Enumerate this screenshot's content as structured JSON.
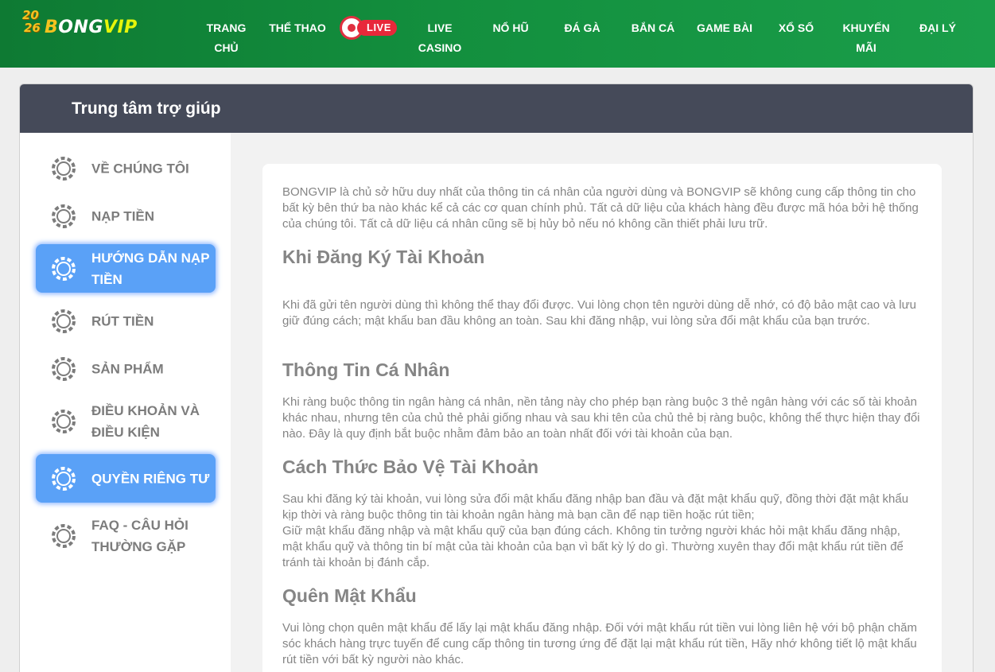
{
  "header": {
    "logo": {
      "year_top": "20",
      "year_bottom": "26",
      "brand_a": "B",
      "brand_b": "ONG",
      "brand_c": "VIP"
    },
    "nav": [
      {
        "label": "TRANG CHỦ"
      },
      {
        "label": "THỂ THAO"
      },
      {
        "label": "LIVE"
      },
      {
        "label": "LIVE CASINO"
      },
      {
        "label": "NỔ HŨ"
      },
      {
        "label": "ĐÁ GÀ"
      },
      {
        "label": "BẮN CÁ"
      },
      {
        "label": "GAME BÀI"
      },
      {
        "label": "XỔ SỐ"
      },
      {
        "label": "KHUYẾN MÃI"
      },
      {
        "label": "ĐẠI LÝ"
      }
    ]
  },
  "panel": {
    "title": "Trung tâm trợ giúp"
  },
  "sidebar": {
    "items": [
      {
        "label": "VỀ CHÚNG TÔI",
        "active": false
      },
      {
        "label": "NẠP TIỀN",
        "active": false
      },
      {
        "label": "HƯỚNG DẪN NẠP TIỀN",
        "active": true
      },
      {
        "label": "RÚT TIỀN",
        "active": false
      },
      {
        "label": "SẢN PHẨM",
        "active": false
      },
      {
        "label": "ĐIỀU KHOẢN VÀ ĐIỀU KIỆN",
        "active": false
      },
      {
        "label": "QUYỀN RIÊNG TƯ",
        "active": true
      },
      {
        "label": "FAQ - CÂU HỎI THƯỜNG GẶP",
        "active": false
      }
    ]
  },
  "content": {
    "intro": "BONGVIP là chủ sở hữu duy nhất của thông tin cá nhân của người dùng và BONGVIP sẽ không cung cấp thông tin cho bất kỳ bên thứ ba nào khác kể cả các cơ quan chính phủ. Tất cả dữ liệu của khách hàng đều được mã hóa bởi hệ thống của chúng tôi. Tất cả dữ liệu cá nhân cũng sẽ bị hủy bỏ nếu nó không cần thiết phải lưu trữ.",
    "sections": [
      {
        "heading": "Khi Đăng Ký Tài Khoản",
        "text": "Khi đã gửi tên người dùng thì không thể thay đổi được. Vui lòng chọn tên người dùng dễ nhớ, có độ bảo mật cao và lưu giữ đúng cách; mật khẩu ban đầu không an toàn. Sau khi đăng nhập, vui lòng sửa đổi mật khẩu của bạn trước."
      },
      {
        "heading": "Thông Tin Cá Nhân",
        "text": "Khi ràng buộc thông tin ngân hàng cá nhân, nền tảng này cho phép bạn ràng buộc 3 thẻ ngân hàng với các số tài khoản khác nhau, nhưng tên của chủ thẻ phải giống nhau và sau khi tên của chủ thẻ bị ràng buộc, không thể thực hiện thay đổi nào. Đây là quy định bắt buộc nhằm đảm bảo an toàn nhất đối với tài khoản của bạn."
      },
      {
        "heading": "Cách Thức Bảo Vệ Tài Khoản",
        "text": "Sau khi đăng ký tài khoản, vui lòng sửa đổi mật khẩu đăng nhập ban đầu và đặt mật khẩu quỹ, đồng thời đặt mật khẩu kịp thời và ràng buộc thông tin tài khoản ngân hàng mà bạn cần để nạp tiền hoặc rút tiền;",
        "text2": "Giữ mật khẩu đăng nhập và mật khẩu quỹ của bạn đúng cách. Không tin tưởng người khác hỏi mật khẩu đăng nhập, mật khẩu quỹ và thông tin bí mật của tài khoản của bạn vì bất kỳ lý do gì. Thường xuyên thay đổi mật khẩu rút tiền để tránh tài khoản bị đánh cắp."
      },
      {
        "heading": "Quên Mật Khẩu",
        "text": "Vui lòng chọn quên mật khẩu để lấy lại mật khẩu đăng nhập. Đối với mật khẩu rút tiền vui lòng liên hệ với bộ phận chăm sóc khách hàng trực tuyến để cung cấp thông tin tương ứng để đặt lại mật khẩu rút tiền, Hãy nhớ không tiết lộ mật khẩu rút tiền với bất kỳ người nào khác."
      }
    ]
  },
  "colors": {
    "header_green": "#138f3e",
    "panel_header": "#454a59",
    "active_blue": "#5aa1f7",
    "text_gray": "#858585",
    "live_red": "#e8283a"
  }
}
